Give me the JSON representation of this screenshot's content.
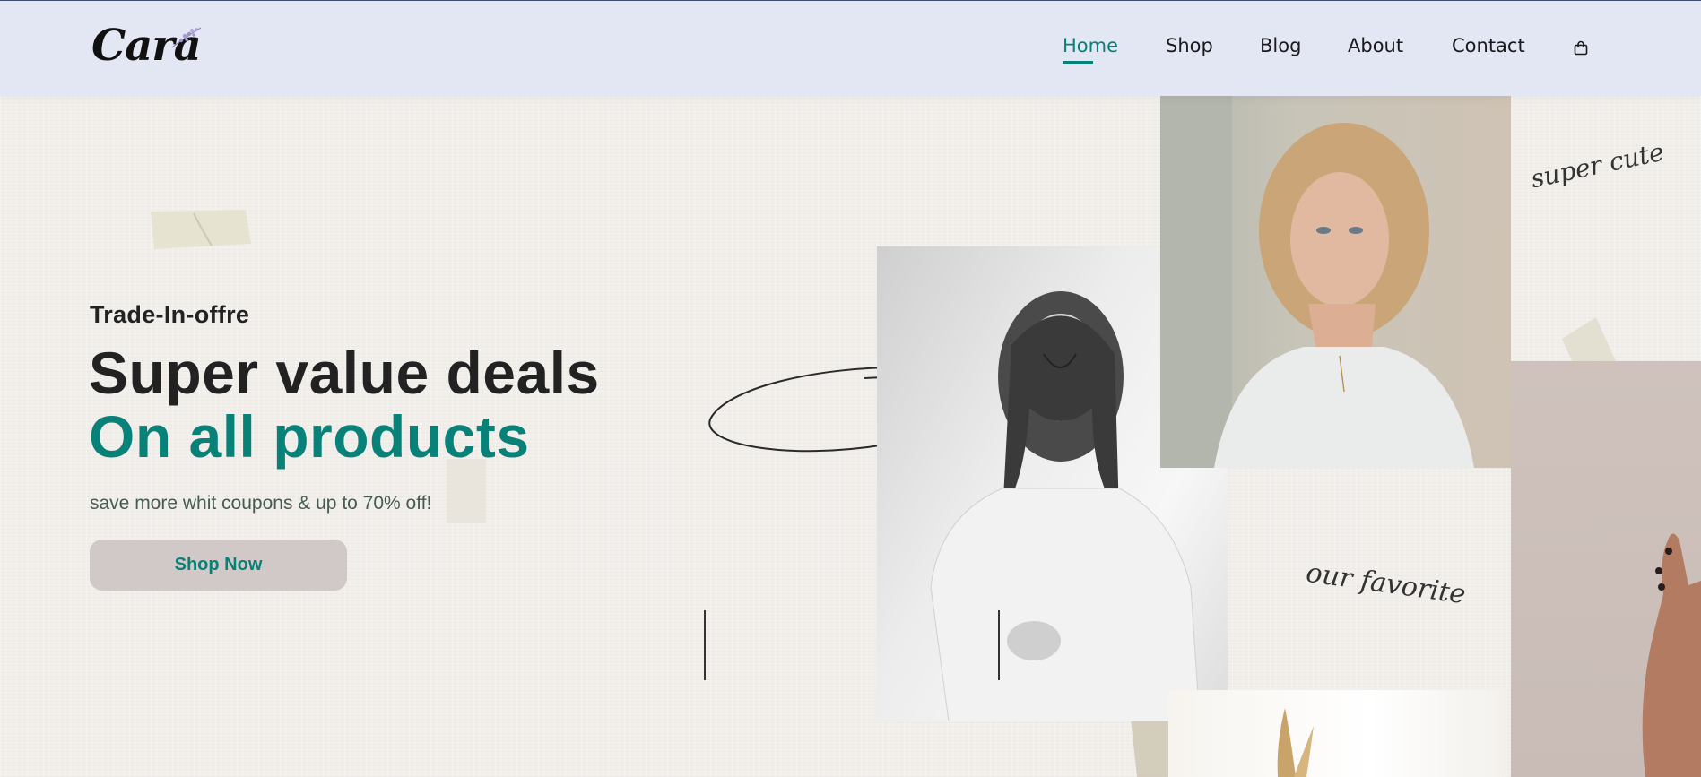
{
  "brand": {
    "logo_text": "Cara"
  },
  "nav": {
    "items": [
      {
        "label": "Home",
        "active": true
      },
      {
        "label": "Shop",
        "active": false
      },
      {
        "label": "Blog",
        "active": false
      },
      {
        "label": "About",
        "active": false
      },
      {
        "label": "Contact",
        "active": false
      }
    ],
    "cart_icon": "shopping-bag-icon",
    "accent_color": "#088178"
  },
  "hero": {
    "subtitle": "Trade-In-offre",
    "title": "Super value deals",
    "title_accent": "On all products",
    "description": "save more whit coupons & up to 70% off!",
    "button_label": "Shop Now"
  },
  "decor": {
    "script_1": "super cute",
    "script_2": "our favorite"
  },
  "colors": {
    "header_bg": "#e3e6f3",
    "page_bg": "#f2efeb",
    "accent": "#088178",
    "button_bg": "#d1c9c7",
    "text_dark": "#222222"
  }
}
